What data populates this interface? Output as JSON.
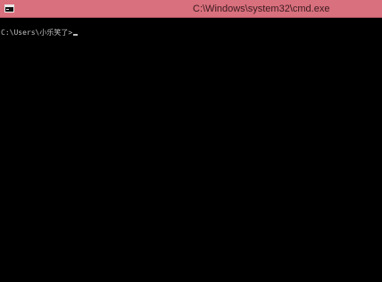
{
  "window": {
    "title": "C:\\Windows\\system32\\cmd.exe",
    "icon": "console-icon",
    "titlebar_color": "#d9707d",
    "background_color": "#000000",
    "text_color": "#c0c0c0"
  },
  "console": {
    "prompt": "C:\\Users\\小乐笑了>"
  }
}
